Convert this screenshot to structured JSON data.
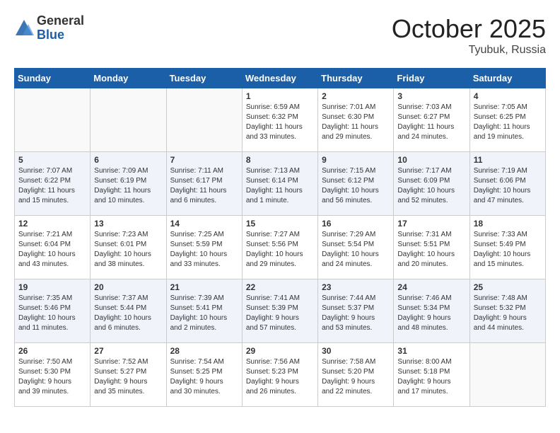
{
  "header": {
    "logo_general": "General",
    "logo_blue": "Blue",
    "month_title": "October 2025",
    "location": "Tyubuk, Russia"
  },
  "weekdays": [
    "Sunday",
    "Monday",
    "Tuesday",
    "Wednesday",
    "Thursday",
    "Friday",
    "Saturday"
  ],
  "weeks": [
    [
      {
        "day": "",
        "info": ""
      },
      {
        "day": "",
        "info": ""
      },
      {
        "day": "",
        "info": ""
      },
      {
        "day": "1",
        "info": "Sunrise: 6:59 AM\nSunset: 6:32 PM\nDaylight: 11 hours\nand 33 minutes."
      },
      {
        "day": "2",
        "info": "Sunrise: 7:01 AM\nSunset: 6:30 PM\nDaylight: 11 hours\nand 29 minutes."
      },
      {
        "day": "3",
        "info": "Sunrise: 7:03 AM\nSunset: 6:27 PM\nDaylight: 11 hours\nand 24 minutes."
      },
      {
        "day": "4",
        "info": "Sunrise: 7:05 AM\nSunset: 6:25 PM\nDaylight: 11 hours\nand 19 minutes."
      }
    ],
    [
      {
        "day": "5",
        "info": "Sunrise: 7:07 AM\nSunset: 6:22 PM\nDaylight: 11 hours\nand 15 minutes."
      },
      {
        "day": "6",
        "info": "Sunrise: 7:09 AM\nSunset: 6:19 PM\nDaylight: 11 hours\nand 10 minutes."
      },
      {
        "day": "7",
        "info": "Sunrise: 7:11 AM\nSunset: 6:17 PM\nDaylight: 11 hours\nand 6 minutes."
      },
      {
        "day": "8",
        "info": "Sunrise: 7:13 AM\nSunset: 6:14 PM\nDaylight: 11 hours\nand 1 minute."
      },
      {
        "day": "9",
        "info": "Sunrise: 7:15 AM\nSunset: 6:12 PM\nDaylight: 10 hours\nand 56 minutes."
      },
      {
        "day": "10",
        "info": "Sunrise: 7:17 AM\nSunset: 6:09 PM\nDaylight: 10 hours\nand 52 minutes."
      },
      {
        "day": "11",
        "info": "Sunrise: 7:19 AM\nSunset: 6:06 PM\nDaylight: 10 hours\nand 47 minutes."
      }
    ],
    [
      {
        "day": "12",
        "info": "Sunrise: 7:21 AM\nSunset: 6:04 PM\nDaylight: 10 hours\nand 43 minutes."
      },
      {
        "day": "13",
        "info": "Sunrise: 7:23 AM\nSunset: 6:01 PM\nDaylight: 10 hours\nand 38 minutes."
      },
      {
        "day": "14",
        "info": "Sunrise: 7:25 AM\nSunset: 5:59 PM\nDaylight: 10 hours\nand 33 minutes."
      },
      {
        "day": "15",
        "info": "Sunrise: 7:27 AM\nSunset: 5:56 PM\nDaylight: 10 hours\nand 29 minutes."
      },
      {
        "day": "16",
        "info": "Sunrise: 7:29 AM\nSunset: 5:54 PM\nDaylight: 10 hours\nand 24 minutes."
      },
      {
        "day": "17",
        "info": "Sunrise: 7:31 AM\nSunset: 5:51 PM\nDaylight: 10 hours\nand 20 minutes."
      },
      {
        "day": "18",
        "info": "Sunrise: 7:33 AM\nSunset: 5:49 PM\nDaylight: 10 hours\nand 15 minutes."
      }
    ],
    [
      {
        "day": "19",
        "info": "Sunrise: 7:35 AM\nSunset: 5:46 PM\nDaylight: 10 hours\nand 11 minutes."
      },
      {
        "day": "20",
        "info": "Sunrise: 7:37 AM\nSunset: 5:44 PM\nDaylight: 10 hours\nand 6 minutes."
      },
      {
        "day": "21",
        "info": "Sunrise: 7:39 AM\nSunset: 5:41 PM\nDaylight: 10 hours\nand 2 minutes."
      },
      {
        "day": "22",
        "info": "Sunrise: 7:41 AM\nSunset: 5:39 PM\nDaylight: 9 hours\nand 57 minutes."
      },
      {
        "day": "23",
        "info": "Sunrise: 7:44 AM\nSunset: 5:37 PM\nDaylight: 9 hours\nand 53 minutes."
      },
      {
        "day": "24",
        "info": "Sunrise: 7:46 AM\nSunset: 5:34 PM\nDaylight: 9 hours\nand 48 minutes."
      },
      {
        "day": "25",
        "info": "Sunrise: 7:48 AM\nSunset: 5:32 PM\nDaylight: 9 hours\nand 44 minutes."
      }
    ],
    [
      {
        "day": "26",
        "info": "Sunrise: 7:50 AM\nSunset: 5:30 PM\nDaylight: 9 hours\nand 39 minutes."
      },
      {
        "day": "27",
        "info": "Sunrise: 7:52 AM\nSunset: 5:27 PM\nDaylight: 9 hours\nand 35 minutes."
      },
      {
        "day": "28",
        "info": "Sunrise: 7:54 AM\nSunset: 5:25 PM\nDaylight: 9 hours\nand 30 minutes."
      },
      {
        "day": "29",
        "info": "Sunrise: 7:56 AM\nSunset: 5:23 PM\nDaylight: 9 hours\nand 26 minutes."
      },
      {
        "day": "30",
        "info": "Sunrise: 7:58 AM\nSunset: 5:20 PM\nDaylight: 9 hours\nand 22 minutes."
      },
      {
        "day": "31",
        "info": "Sunrise: 8:00 AM\nSunset: 5:18 PM\nDaylight: 9 hours\nand 17 minutes."
      },
      {
        "day": "",
        "info": ""
      }
    ]
  ]
}
